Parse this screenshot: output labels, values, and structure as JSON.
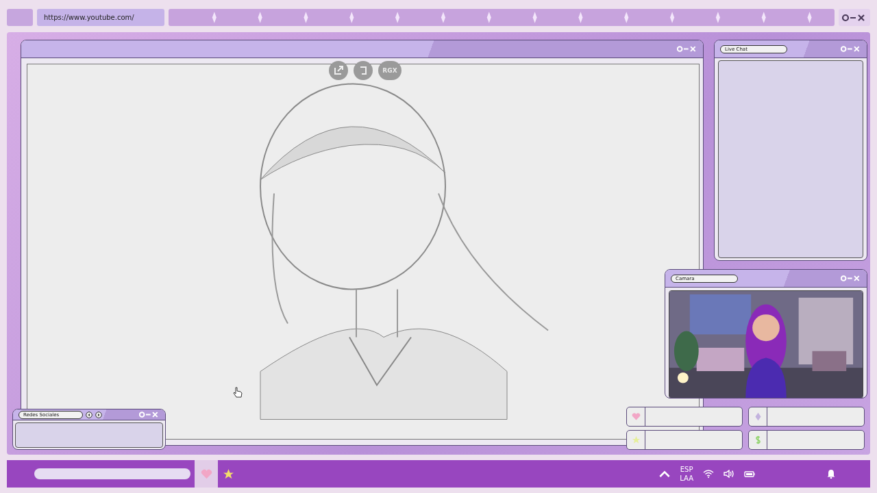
{
  "browser_bar": {
    "url": "https://www.youtube.com/"
  },
  "video": {
    "player_label": "RGX"
  },
  "live_chat": {
    "title": "Live Chat"
  },
  "camera": {
    "title": "Camara"
  },
  "social": {
    "title": "Redes Sociales"
  },
  "alert_slots": [
    {
      "kind": "heart"
    },
    {
      "kind": "diamond"
    },
    {
      "kind": "star"
    },
    {
      "kind": "dollar"
    }
  ],
  "taskbar": {
    "apps": [
      {
        "kind": "heart",
        "selected": true
      },
      {
        "kind": "star",
        "selected": false
      }
    ],
    "language": [
      "ESP",
      "LAA"
    ]
  }
}
